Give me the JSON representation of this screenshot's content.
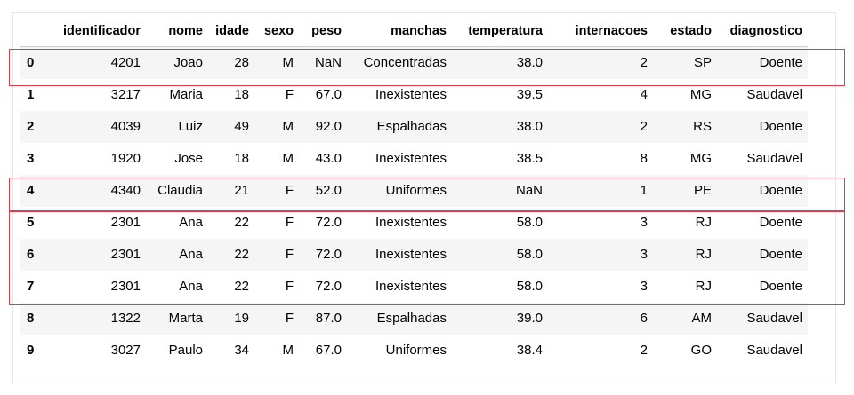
{
  "table": {
    "index_header": "",
    "columns": [
      "identificador",
      "nome",
      "idade",
      "sexo",
      "peso",
      "manchas",
      "temperatura",
      "internacoes",
      "estado",
      "diagnostico"
    ],
    "rows": [
      {
        "index": "0",
        "cells": [
          "4201",
          "Joao",
          "28",
          "M",
          "NaN",
          "Concentradas",
          "38.0",
          "2",
          "SP",
          "Doente"
        ]
      },
      {
        "index": "1",
        "cells": [
          "3217",
          "Maria",
          "18",
          "F",
          "67.0",
          "Inexistentes",
          "39.5",
          "4",
          "MG",
          "Saudavel"
        ]
      },
      {
        "index": "2",
        "cells": [
          "4039",
          "Luiz",
          "49",
          "M",
          "92.0",
          "Espalhadas",
          "38.0",
          "2",
          "RS",
          "Doente"
        ]
      },
      {
        "index": "3",
        "cells": [
          "1920",
          "Jose",
          "18",
          "M",
          "43.0",
          "Inexistentes",
          "38.5",
          "8",
          "MG",
          "Saudavel"
        ]
      },
      {
        "index": "4",
        "cells": [
          "4340",
          "Claudia",
          "21",
          "F",
          "52.0",
          "Uniformes",
          "NaN",
          "1",
          "PE",
          "Doente"
        ]
      },
      {
        "index": "5",
        "cells": [
          "2301",
          "Ana",
          "22",
          "F",
          "72.0",
          "Inexistentes",
          "58.0",
          "3",
          "RJ",
          "Doente"
        ]
      },
      {
        "index": "6",
        "cells": [
          "2301",
          "Ana",
          "22",
          "F",
          "72.0",
          "Inexistentes",
          "58.0",
          "3",
          "RJ",
          "Doente"
        ]
      },
      {
        "index": "7",
        "cells": [
          "2301",
          "Ana",
          "22",
          "F",
          "72.0",
          "Inexistentes",
          "58.0",
          "3",
          "RJ",
          "Doente"
        ]
      },
      {
        "index": "8",
        "cells": [
          "1322",
          "Marta",
          "19",
          "F",
          "87.0",
          "Espalhadas",
          "39.0",
          "6",
          "AM",
          "Saudavel"
        ]
      },
      {
        "index": "9",
        "cells": [
          "3027",
          "Paulo",
          "34",
          "M",
          "67.0",
          "Uniformes",
          "38.4",
          "2",
          "GO",
          "Saudavel"
        ]
      }
    ]
  },
  "highlight_color": "#d9404a"
}
